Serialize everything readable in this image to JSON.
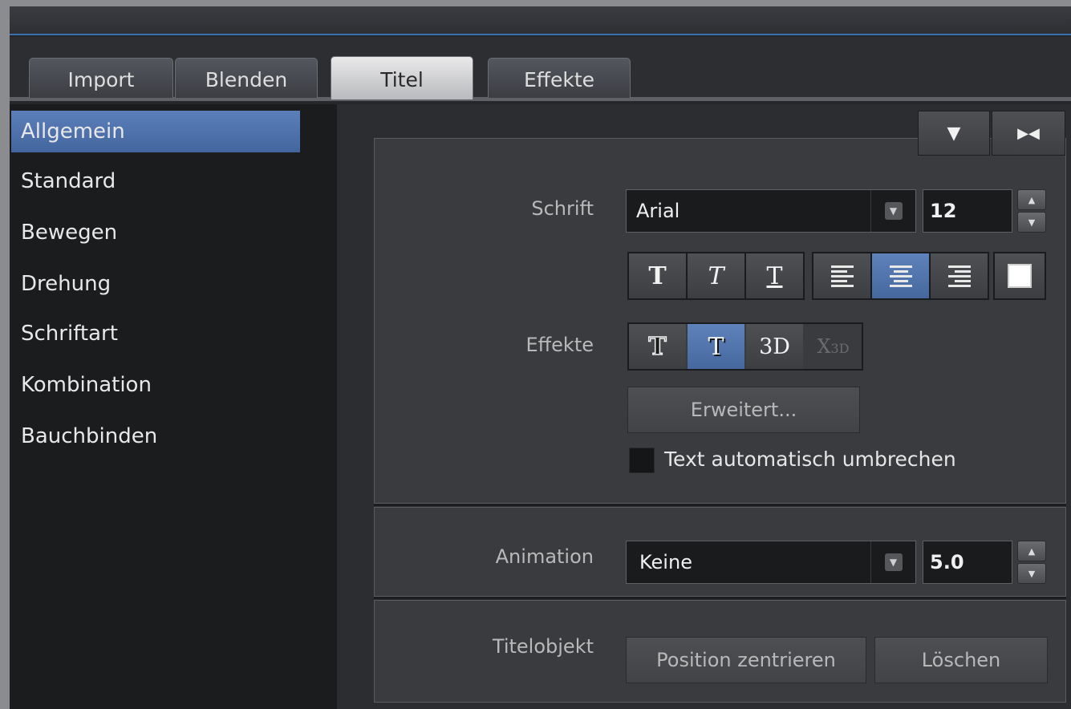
{
  "tabs": [
    {
      "label": "Import",
      "active": false
    },
    {
      "label": "Blenden",
      "active": false
    },
    {
      "label": "Titel",
      "active": true
    },
    {
      "label": "Effekte",
      "active": false
    }
  ],
  "sidebar": {
    "items": [
      {
        "label": "Allgemein",
        "active": true
      },
      {
        "label": "Standard",
        "active": false
      },
      {
        "label": "Bewegen",
        "active": false
      },
      {
        "label": "Drehung",
        "active": false
      },
      {
        "label": "Schriftart",
        "active": false
      },
      {
        "label": "Kombination",
        "active": false
      },
      {
        "label": "Bauchbinden",
        "active": false
      }
    ]
  },
  "panel_controls": {
    "collapse_icon": "▼",
    "dock_icon": "▶◀"
  },
  "font": {
    "label": "Schrift",
    "family": "Arial",
    "size": "12"
  },
  "style_buttons": [
    {
      "name": "bold",
      "glyph": "T",
      "active": false
    },
    {
      "name": "italic",
      "glyph": "T",
      "active": false
    },
    {
      "name": "underline",
      "glyph": "T",
      "active": false
    }
  ],
  "align_buttons": [
    {
      "name": "align-left",
      "active": false
    },
    {
      "name": "align-center",
      "active": true
    },
    {
      "name": "align-right",
      "active": false
    }
  ],
  "effects": {
    "label": "Effekte",
    "buttons": [
      {
        "name": "outline",
        "glyph": "T",
        "active": false
      },
      {
        "name": "shadow",
        "glyph": "T",
        "active": true
      },
      {
        "name": "3d",
        "glyph": "3D",
        "active": false
      },
      {
        "name": "x3d",
        "glyph": "X3D",
        "active": false,
        "disabled": true
      }
    ],
    "advanced_label": "Erweitert...",
    "wrap_label": "Text automatisch umbrechen",
    "wrap_checked": false
  },
  "animation": {
    "label": "Animation",
    "value": "Keine",
    "duration": "5.0"
  },
  "title_object": {
    "label": "Titelobjekt",
    "center_label": "Position zentrieren",
    "delete_label": "Löschen"
  },
  "colors": {
    "accent": "#5b7fba",
    "background": "#26272a",
    "panel": "#3a3b3e"
  }
}
